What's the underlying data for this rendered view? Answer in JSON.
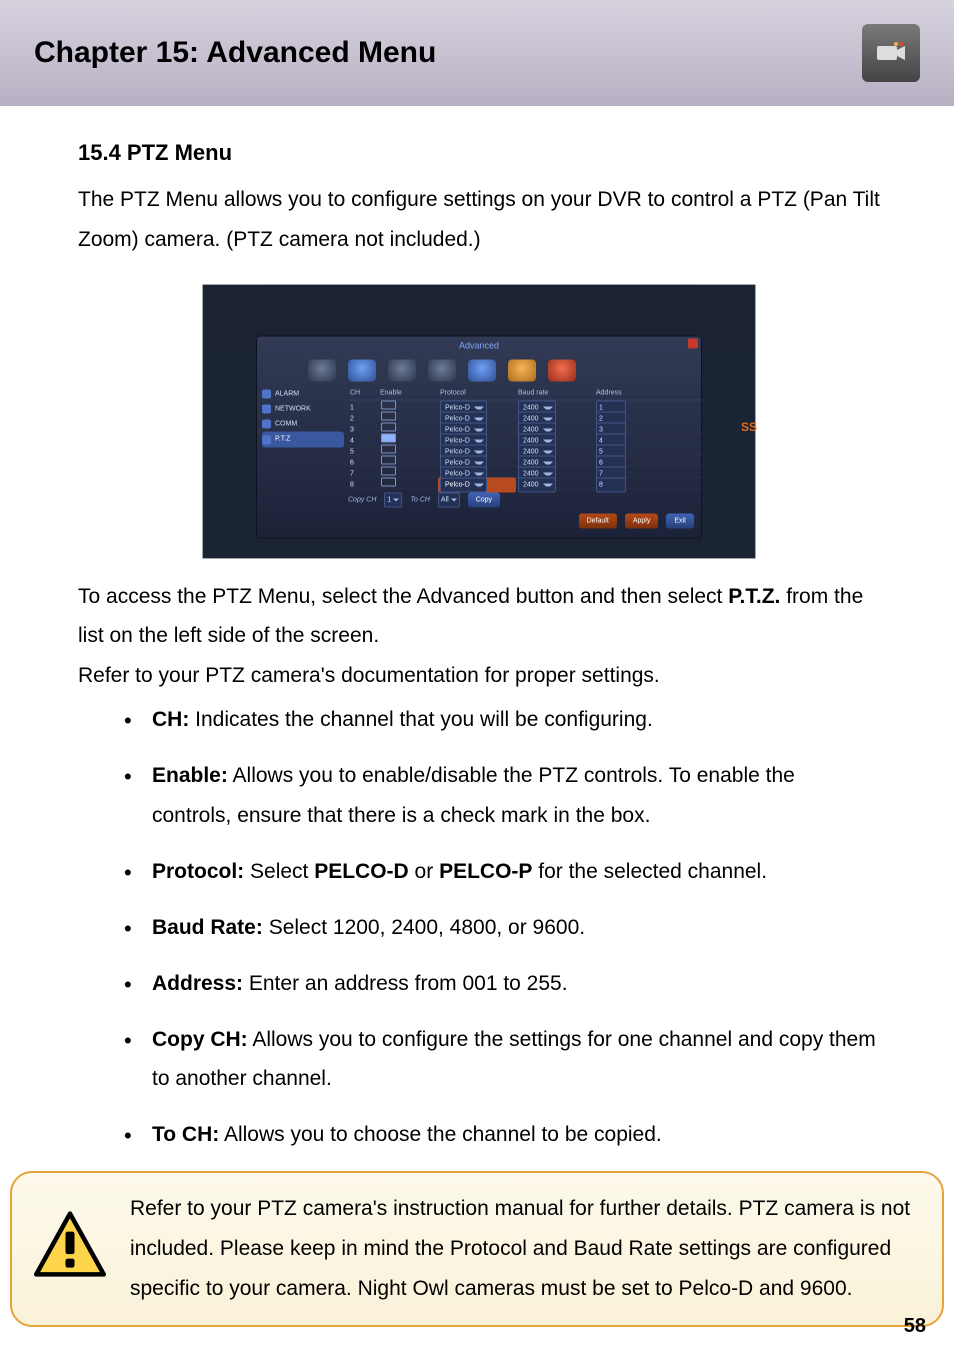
{
  "header": {
    "title": "Chapter 15: Advanced Menu"
  },
  "section": {
    "heading": "15.4 PTZ Menu",
    "intro": "The PTZ Menu allows you to configure settings on your DVR to control a PTZ (Pan Tilt Zoom) camera. (PTZ camera not included.)",
    "access1": "To access the PTZ Menu, select the Advanced button and then select ",
    "access_bold": "P.T.Z.",
    "access2": " from the list on the left side of the screen.",
    "refer": "Refer to your PTZ camera's documentation for proper settings."
  },
  "screenshot": {
    "window_title": "Advanced",
    "badge": "SS",
    "sidebar": [
      {
        "icon": "alarm-icon",
        "label": "ALARM"
      },
      {
        "icon": "network-icon",
        "label": "NETWORK"
      },
      {
        "icon": "comm-icon",
        "label": "COMM"
      },
      {
        "icon": "ptz-icon",
        "label": "P.T.Z"
      }
    ],
    "columns": {
      "c1": "CH",
      "c2": "Enable",
      "c3": "Protocol",
      "c4": "Baud rate",
      "c5": "Address"
    },
    "rows": [
      {
        "ch": "1",
        "enable": false,
        "protocol": "Pelco-D",
        "baud": "2400",
        "addr": "1"
      },
      {
        "ch": "2",
        "enable": false,
        "protocol": "Pelco-D",
        "baud": "2400",
        "addr": "2"
      },
      {
        "ch": "3",
        "enable": false,
        "protocol": "Pelco-D",
        "baud": "2400",
        "addr": "3"
      },
      {
        "ch": "4",
        "enable": true,
        "protocol": "Pelco-D",
        "baud": "2400",
        "addr": "4"
      },
      {
        "ch": "5",
        "enable": false,
        "protocol": "Pelco-D",
        "baud": "2400",
        "addr": "5"
      },
      {
        "ch": "6",
        "enable": false,
        "protocol": "Pelco-D",
        "baud": "2400",
        "addr": "6"
      },
      {
        "ch": "7",
        "enable": false,
        "protocol": "Pelco-D",
        "baud": "2400",
        "addr": "7"
      },
      {
        "ch": "8",
        "enable": false,
        "protocol": "Pelco-D",
        "baud": "2400",
        "addr": "8",
        "selected": true
      }
    ],
    "copy": {
      "copy_ch_label": "Copy CH",
      "copy_ch_value": "1",
      "to_ch_label": "To CH",
      "to_ch_value": "All",
      "copy_btn": "Copy"
    },
    "buttons": {
      "default": "Default",
      "apply": "Apply",
      "exit": "Exit"
    }
  },
  "fields": [
    {
      "name": "CH:",
      "desc": " Indicates the channel that you will be configuring."
    },
    {
      "name": "Enable:",
      "desc": " Allows you to enable/disable the PTZ controls. To enable the controls, ensure that there is a check mark in the box."
    },
    {
      "name": "Protocol:",
      "desc_parts": [
        " Select ",
        "PELCO-D",
        " or ",
        "PELCO-P",
        " for the selected channel."
      ]
    },
    {
      "name": "Baud Rate:",
      "desc": " Select 1200, 2400, 4800, or 9600."
    },
    {
      "name": "Address:",
      "desc": " Enter an address from 001 to 255."
    },
    {
      "name": "Copy CH:",
      "desc": " Allows you to configure the settings for one channel and copy them to another channel."
    },
    {
      "name": "To CH:",
      "desc": " Allows you to choose the channel to be copied."
    }
  ],
  "note": "Refer to your PTZ camera's instruction manual for further details. PTZ camera is not included. Please keep in mind the Protocol and Baud Rate settings are configured specific to your camera. Night Owl cameras must be set to Pelco-D and 9600.",
  "page_number": "58"
}
